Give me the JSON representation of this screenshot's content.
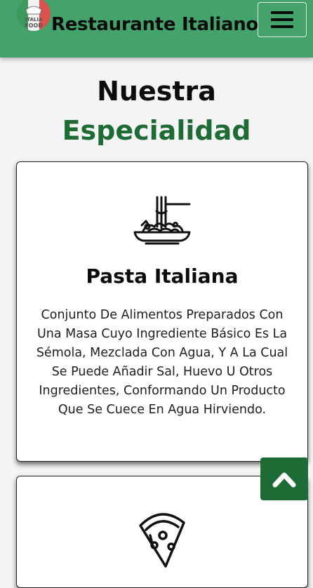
{
  "header": {
    "brand": "Restaurante Italiano",
    "logo_text": "ITALIA FOOD",
    "menu_icon": "hamburger-icon"
  },
  "section": {
    "title_line1": "Nuestra",
    "title_line2": "Especialidad"
  },
  "cards": [
    {
      "icon": "pasta-icon",
      "title": "Pasta Italiana",
      "description": "Conjunto De Alimentos Preparados Con Una Masa Cuyo Ingrediente Básico Es La Sémola, Mezclada Con Agua, Y A La Cual Se Puede Añadir Sal, Huevo U Otros Ingredientes, Conformando Un Producto Que Se Cuece En Agua Hirviendo."
    },
    {
      "icon": "pizza-icon"
    }
  ],
  "scroll_top_icon": "chevron-up-icon",
  "colors": {
    "header_bg": "#44a36a",
    "accent": "#1e6b35",
    "page_bg": "#f4f4f4"
  }
}
